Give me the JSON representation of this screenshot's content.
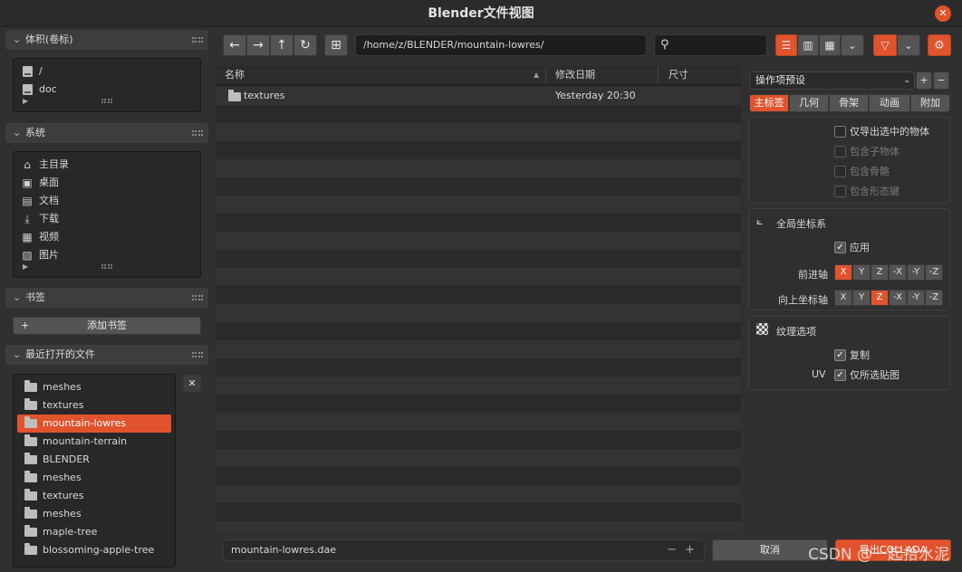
{
  "window": {
    "title": "Blender文件视图",
    "close_icon": "close-icon"
  },
  "sidebar": {
    "volumes": {
      "title": "体积(卷标)",
      "items": [
        {
          "label": "/",
          "icon": "drive-icon"
        },
        {
          "label": "doc",
          "icon": "drive-icon"
        }
      ]
    },
    "system": {
      "title": "系统",
      "items": [
        {
          "label": "主目录",
          "icon": "home-icon"
        },
        {
          "label": "桌面",
          "icon": "desktop-icon"
        },
        {
          "label": "文档",
          "icon": "document-icon"
        },
        {
          "label": "下载",
          "icon": "download-icon"
        },
        {
          "label": "视频",
          "icon": "video-icon"
        },
        {
          "label": "图片",
          "icon": "image-icon"
        }
      ]
    },
    "bookmarks": {
      "title": "书签",
      "add_label": "添加书签"
    },
    "recent": {
      "title": "最近打开的文件",
      "items": [
        {
          "label": "meshes"
        },
        {
          "label": "textures"
        },
        {
          "label": "mountain-lowres",
          "selected": true
        },
        {
          "label": "mountain-terrain"
        },
        {
          "label": "BLENDER"
        },
        {
          "label": "meshes"
        },
        {
          "label": "textures"
        },
        {
          "label": "meshes"
        },
        {
          "label": "maple-tree"
        },
        {
          "label": "blossoming-apple-tree"
        }
      ]
    }
  },
  "toolbar": {
    "path": "/home/z/BLENDER/mountain-lowres/",
    "search_placeholder": "",
    "back_glyph": "←",
    "forward_glyph": "→",
    "parent_glyph": "↑",
    "refresh_glyph": "↻"
  },
  "filelist": {
    "columns": {
      "name": "名称",
      "date": "修改日期",
      "size": "尺寸"
    },
    "files": [
      {
        "name": "textures",
        "date": "Yesterday 20:30",
        "size": ""
      }
    ]
  },
  "operator": {
    "preset_label": "操作项预设",
    "tabs": [
      {
        "label": "主标签",
        "active": true
      },
      {
        "label": "几何"
      },
      {
        "label": "骨架"
      },
      {
        "label": "动画"
      },
      {
        "label": "附加"
      }
    ],
    "main": {
      "export_selected": "仅导出选中的物体",
      "include_children": "包含子物体",
      "include_armatures": "包含骨骼",
      "include_shapekeys": "包含形态键"
    },
    "global_orientation": {
      "title": "全局坐标系",
      "apply_label": "应用",
      "forward_label": "前进轴",
      "up_label": "向上坐标轴",
      "axes": [
        "X",
        "Y",
        "Z",
        "-X",
        "-Y",
        "-Z"
      ],
      "forward_selected": "X",
      "up_selected": "Z"
    },
    "texture": {
      "title": "纹理选项",
      "copy_label": "复制",
      "uv_label": "UV",
      "uv_only_selected": "仅所选贴图"
    }
  },
  "footer": {
    "filename": "mountain-lowres.dae",
    "minus": "−",
    "plus": "+",
    "cancel_label": "取消",
    "export_label": "导出COLLADA",
    "watermark": "CSDN @一起拾水泥"
  },
  "colors": {
    "accent": "#e0532c",
    "panel_bg": "#303030",
    "list_alt": "#333333"
  }
}
